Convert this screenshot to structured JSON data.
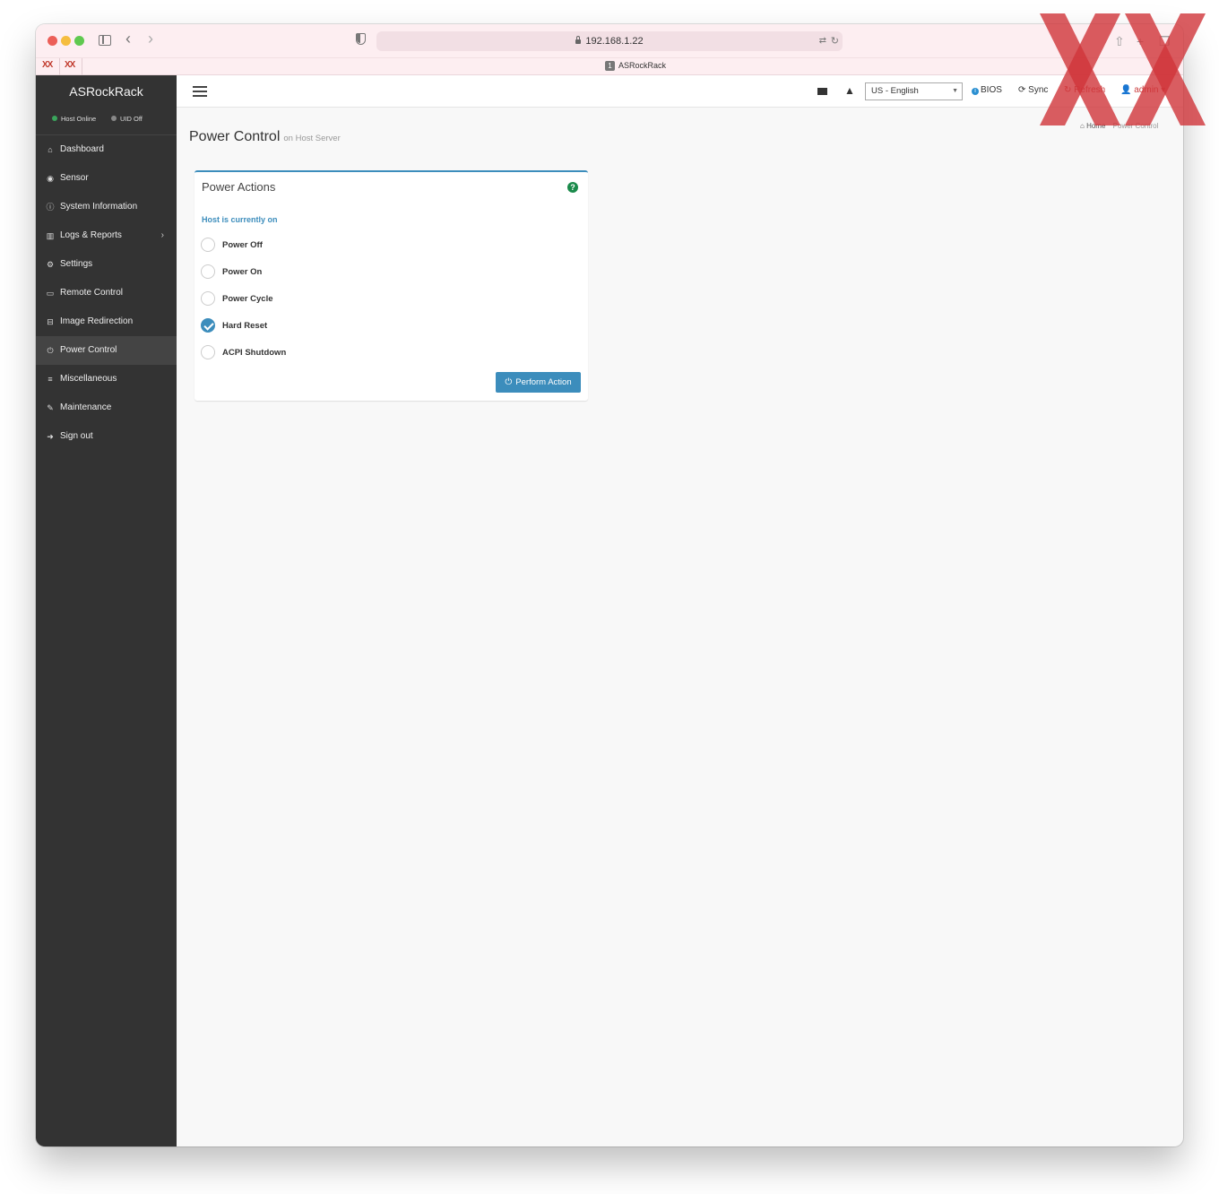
{
  "browser": {
    "url": "192.168.1.22",
    "tab_title": "ASRockRack",
    "tab_number": "1",
    "pinned_tabs": [
      "XX",
      "XX"
    ]
  },
  "sidebar": {
    "brand": "ASRockRack",
    "host_status": "Host Online",
    "uid_status": "UID Off",
    "items": [
      {
        "label": "Dashboard",
        "icon": "home-icon",
        "glyph": "⌂"
      },
      {
        "label": "Sensor",
        "icon": "gauge-icon",
        "glyph": "◉"
      },
      {
        "label": "System Information",
        "icon": "info-icon",
        "glyph": "ⓘ"
      },
      {
        "label": "Logs & Reports",
        "icon": "bar-chart-icon",
        "glyph": "▥",
        "has_children": true
      },
      {
        "label": "Settings",
        "icon": "gear-icon",
        "glyph": "⚙"
      },
      {
        "label": "Remote Control",
        "icon": "monitor-icon",
        "glyph": "▭"
      },
      {
        "label": "Image Redirection",
        "icon": "drive-icon",
        "glyph": "⊟"
      },
      {
        "label": "Power Control",
        "icon": "power-icon",
        "glyph": "⏻",
        "active": true
      },
      {
        "label": "Miscellaneous",
        "icon": "list-icon",
        "glyph": "≡"
      },
      {
        "label": "Maintenance",
        "icon": "wrench-icon",
        "glyph": "✎"
      },
      {
        "label": "Sign out",
        "icon": "sign-out-icon",
        "glyph": "➜"
      }
    ]
  },
  "topbar": {
    "language": "US - English",
    "bios": "BIOS",
    "sync": "Sync",
    "refresh": "Refresh",
    "user": "admin"
  },
  "breadcrumb": {
    "home": "Home",
    "current": "Power Control"
  },
  "page": {
    "title": "Power Control",
    "subtitle": "on Host Server"
  },
  "panel": {
    "title": "Power Actions",
    "host_status": "Host is currently on",
    "options": [
      {
        "label": "Power Off",
        "checked": false
      },
      {
        "label": "Power On",
        "checked": false
      },
      {
        "label": "Power Cycle",
        "checked": false
      },
      {
        "label": "Hard Reset",
        "checked": true
      },
      {
        "label": "ACPI Shutdown",
        "checked": false
      }
    ],
    "button": "Perform Action"
  },
  "colors": {
    "sidebar_bg": "#333333",
    "accent": "#3c8dbc",
    "help_green": "#1a8a4a",
    "watermark_red": "#d0353a"
  }
}
